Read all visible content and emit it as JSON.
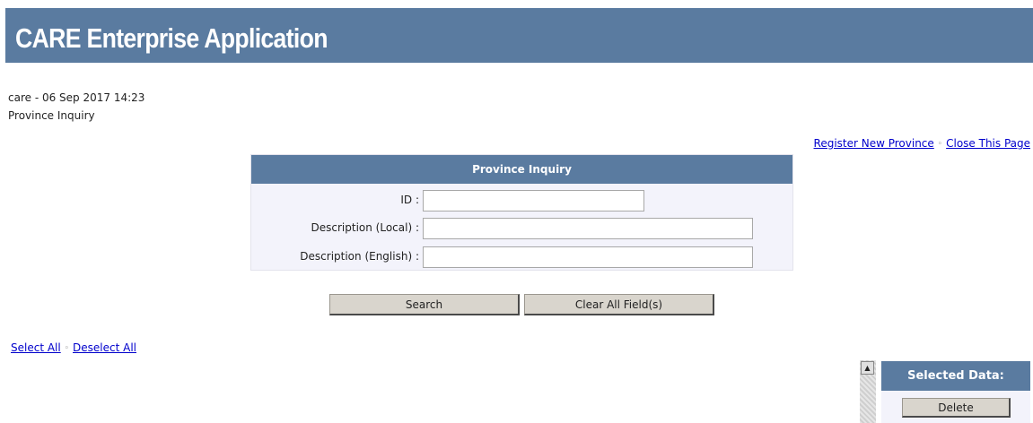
{
  "app": {
    "title": "CARE Enterprise Application"
  },
  "meta": {
    "user_date": "care - 06 Sep 2017 14:23",
    "page_name": "Province Inquiry"
  },
  "top_links": {
    "register": "Register New Province",
    "separator": "◦",
    "close": "Close This Page"
  },
  "form": {
    "header": "Province Inquiry",
    "fields": [
      {
        "label": "ID :",
        "value": "",
        "placeholder": ""
      },
      {
        "label": "Description (Local) :",
        "value": "",
        "placeholder": ""
      },
      {
        "label": "Description (English) :",
        "value": "",
        "placeholder": ""
      }
    ]
  },
  "buttons": {
    "search": "Search",
    "clear": "Clear All Field(s)"
  },
  "selection_links": {
    "select_all": "Select All",
    "separator": "◦",
    "deselect_all": "Deselect All"
  },
  "selected_panel": {
    "title": "Selected Data:",
    "delete": "Delete"
  },
  "icons": {
    "scroll_up": "scroll-up-arrow-icon"
  },
  "colors": {
    "header_blue": "#5a7ba0",
    "panel_bg": "#f3f3fb",
    "button_bg": "#d9d5cd",
    "link": "#0000cc"
  }
}
